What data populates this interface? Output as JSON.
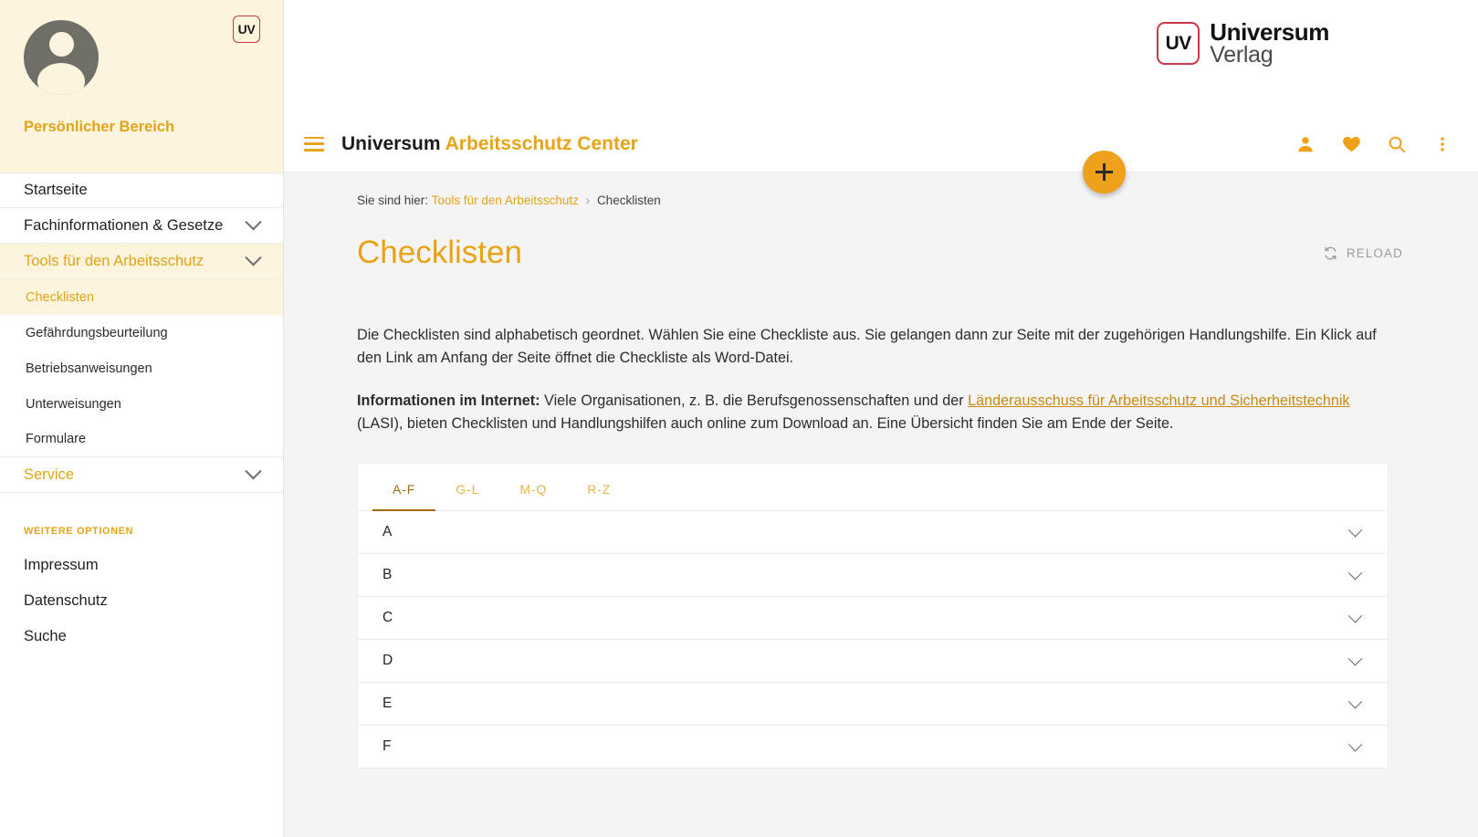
{
  "sidebar": {
    "logo_badge": "UV",
    "profile_label": "Persönlicher Bereich",
    "avatar_icon": "user-avatar-icon",
    "nav": [
      {
        "label": "Startseite",
        "expandable": false,
        "accent": false
      },
      {
        "label": "Fachinformationen & Gesetze",
        "expandable": true,
        "accent": false
      },
      {
        "label": "Tools für den Arbeitsschutz",
        "expandable": true,
        "accent": true
      }
    ],
    "subnav": [
      {
        "label": "Checklisten",
        "active": true
      },
      {
        "label": "Gefährdungsbeurteilung",
        "active": false
      },
      {
        "label": "Betriebsanweisungen",
        "active": false
      },
      {
        "label": "Unterweisungen",
        "active": false
      },
      {
        "label": "Formulare",
        "active": false
      }
    ],
    "service": {
      "label": "Service",
      "expandable": true
    },
    "options_heading": "WEITERE OPTIONEN",
    "options": [
      {
        "label": "Impressum"
      },
      {
        "label": "Datenschutz"
      },
      {
        "label": "Suche"
      }
    ]
  },
  "brand": {
    "mark": "UV",
    "line1": "Universum",
    "line2": "Verlag"
  },
  "topbar": {
    "menu_icon": "hamburger-menu-icon",
    "title_primary": "Universum",
    "title_accent": "Arbeitsschutz Center",
    "icons": [
      {
        "name": "person-icon"
      },
      {
        "name": "heart-icon"
      },
      {
        "name": "search-icon"
      },
      {
        "name": "more-vertical-icon"
      }
    ],
    "fab_icon": "plus-icon"
  },
  "breadcrumb": {
    "prefix": "Sie sind hier:",
    "link": "Tools für den Arbeitsschutz",
    "separator": "›",
    "current": "Checklisten"
  },
  "page": {
    "title": "Checklisten",
    "reload_label": "RELOAD",
    "reload_icon": "refresh-icon",
    "paragraph1": "Die Checklisten sind alphabetisch geordnet. Wählen Sie eine Checkliste aus. Sie gelangen dann zur Seite mit der zugehörigen Handlungshilfe. Ein Klick auf den Link am Anfang der Seite öffnet die Checkliste als Word-Datei.",
    "paragraph2": {
      "bold_lead": "Informationen im Internet:",
      "text_before_link": " Viele Organisationen, z. B. die Berufsgenossenschaften und der ",
      "link_text": "Länderausschuss für Arbeitsschutz und Sicherheitstechnik",
      "text_after_link": " (LASI), bieten Checklisten und Handlungshilfen auch online zum Download an. Eine Übersicht finden Sie am Ende der Seite."
    }
  },
  "tabs": [
    {
      "label": "A-F",
      "active": true
    },
    {
      "label": "G-L",
      "active": false
    },
    {
      "label": "M-Q",
      "active": false
    },
    {
      "label": "R-Z",
      "active": false
    }
  ],
  "accordion": [
    {
      "label": "A",
      "icon": "chevron-down-icon"
    },
    {
      "label": "B",
      "icon": "chevron-down-icon"
    },
    {
      "label": "C",
      "icon": "chevron-down-icon"
    },
    {
      "label": "D",
      "icon": "chevron-down-icon"
    },
    {
      "label": "E",
      "icon": "chevron-down-icon"
    },
    {
      "label": "F",
      "icon": "chevron-down-icon"
    }
  ],
  "colors": {
    "accent": "#e8a317",
    "accent_dark": "#a36b10",
    "profile_bg": "#fdf4dd",
    "brand_red": "#c8364a",
    "page_bg": "#f4f4f4"
  }
}
